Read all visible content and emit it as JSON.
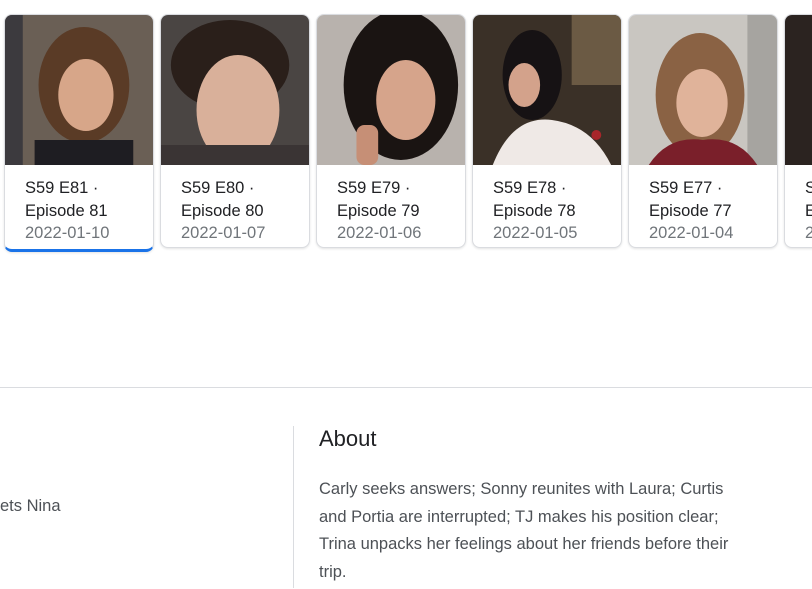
{
  "episodes": [
    {
      "line1": "S59 E81 ·",
      "line2": "Episode 81",
      "date": "2022-01-10"
    },
    {
      "line1": "S59 E80 ·",
      "line2": "Episode 80",
      "date": "2022-01-07"
    },
    {
      "line1": "S59 E79 ·",
      "line2": "Episode 79",
      "date": "2022-01-06"
    },
    {
      "line1": "S59 E78 ·",
      "line2": "Episode 78",
      "date": "2022-01-05"
    },
    {
      "line1": "S59 E77 ·",
      "line2": "Episode 77",
      "date": "2022-01-04"
    },
    {
      "line1": "S",
      "line2": "E",
      "date": "2"
    }
  ],
  "left_panel": {
    "text": "ets Nina"
  },
  "about": {
    "title": "About",
    "body": "Carly seeks answers; Sonny reunites with Laura; Curtis and Portia are interrupted; TJ makes his position clear; Trina unpacks her feelings about her friends before their trip."
  },
  "colors": {
    "accent": "#1a73e8",
    "divider": "#dadce0"
  }
}
